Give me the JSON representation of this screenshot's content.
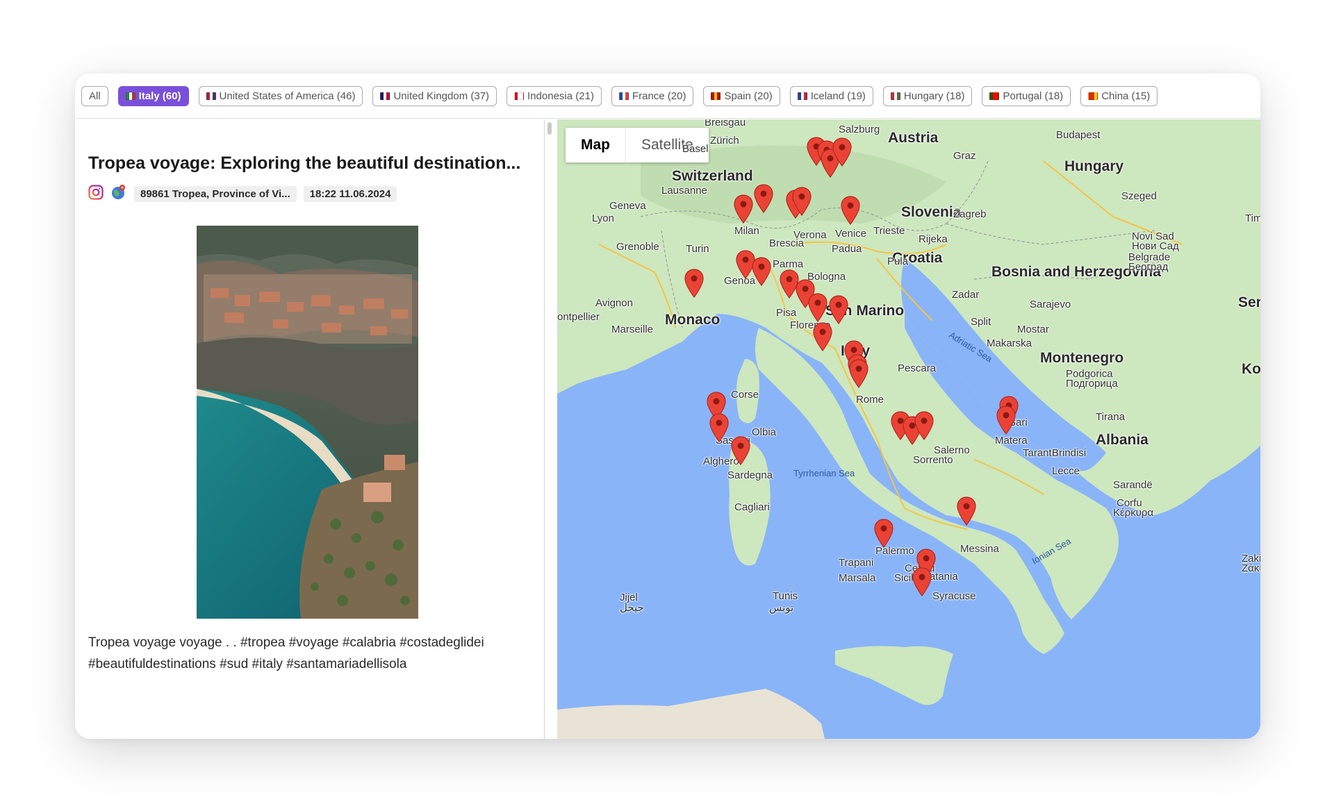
{
  "filters": [
    {
      "label": "All",
      "flag": null,
      "active": false
    },
    {
      "label": "Italy (60)",
      "flag": [
        "#009246",
        "#ffffff",
        "#ce2b37"
      ],
      "active": true
    },
    {
      "label": "United States of America (46)",
      "flag": [
        "#b22234",
        "#ffffff",
        "#3c3b6e"
      ],
      "active": false
    },
    {
      "label": "United Kingdom (37)",
      "flag": [
        "#012169",
        "#ffffff",
        "#c8102e"
      ],
      "active": false
    },
    {
      "label": "Indonesia (21)",
      "flag": [
        "#ce1126",
        "#ffffff",
        "#ffffff"
      ],
      "active": false
    },
    {
      "label": "France (20)",
      "flag": [
        "#0055a4",
        "#ffffff",
        "#ef4135"
      ],
      "active": false
    },
    {
      "label": "Spain (20)",
      "flag": [
        "#aa151b",
        "#f1bf00",
        "#aa151b"
      ],
      "active": false
    },
    {
      "label": "Iceland (19)",
      "flag": [
        "#02529c",
        "#ffffff",
        "#dc1e35"
      ],
      "active": false
    },
    {
      "label": "Hungary (18)",
      "flag": [
        "#ce2939",
        "#ffffff",
        "#477050"
      ],
      "active": false
    },
    {
      "label": "Portugal (18)",
      "flag": [
        "#006600",
        "#ff0000",
        "#ff0000"
      ],
      "active": false
    },
    {
      "label": "China (15)",
      "flag": [
        "#de2910",
        "#de2910",
        "#ffde00"
      ],
      "active": false
    }
  ],
  "post": {
    "title": "Tropea voyage: Exploring the beautiful destination...",
    "location": "89861 Tropea, Province of Vi...",
    "datetime": "18:22 11.06.2024",
    "caption": "Tropea voyage voyage . . #tropea #voyage #calabria #costadeglidei #beautifuldestinations #sud #italy #santamariadellisola"
  },
  "map": {
    "type_buttons": {
      "map": "Map",
      "satellite": "Satellite"
    },
    "labels": {
      "countries": [
        "Switzerland",
        "Austria",
        "Hungary",
        "Slovenia",
        "Croatia",
        "Bosnia and Herzegovina",
        "Serb",
        "Montenegro",
        "Kos",
        "Albania",
        "Italy",
        "Monaco",
        "San Marino"
      ],
      "cities": [
        "Breisgau",
        "Salzburg",
        "Budapest",
        "Basel",
        "Zürich",
        "Graz",
        "Lausanne",
        "Geneva",
        "Lyon",
        "Milan",
        "Verona",
        "Venice",
        "Trieste",
        "Zagreb",
        "Novi Sad",
        "Нови Сад",
        "Belgrade",
        "Београд",
        "Szeged",
        "Tim",
        "Grenoble",
        "Turin",
        "Brescia",
        "Padua",
        "Rijeka",
        "Parma",
        "Bologna",
        "Pula",
        "Genoa",
        "Avignon",
        "ontpellier",
        "Marseille",
        "Pisa",
        "Florence",
        "Zadar",
        "Sarajevo",
        "Split",
        "Mostar",
        "Makarska",
        "Pescara",
        "Podgorica",
        "Подгорица",
        "Corse",
        "Olbia",
        "Sassari",
        "Alghero",
        "Sardegna",
        "Rome",
        "Tirana",
        "Bari",
        "Matera",
        "Taranto",
        "Brindisi",
        "Lecce",
        "Salerno",
        "Sorrento",
        "Sarandë",
        "Corfu",
        "Κέρκυρα",
        "Cagliari",
        "Palermo",
        "Trapani",
        "Marsala",
        "Messina",
        "Cefalù",
        "Catania",
        "Sicilia",
        "Syracuse",
        "Tunis",
        "تونس",
        "Jijel",
        "جيجل",
        "Zakin",
        "Ζάκυ"
      ],
      "seas": [
        "Adriatic Sea",
        "Tyrrhenian Sea",
        "Ionian Sea"
      ]
    },
    "marker_color": "#ea4335"
  },
  "colors": {
    "accent": "#7950d9",
    "land": "#cfe8c4",
    "water": "#8ab4f8",
    "marker": "#ea4335"
  }
}
